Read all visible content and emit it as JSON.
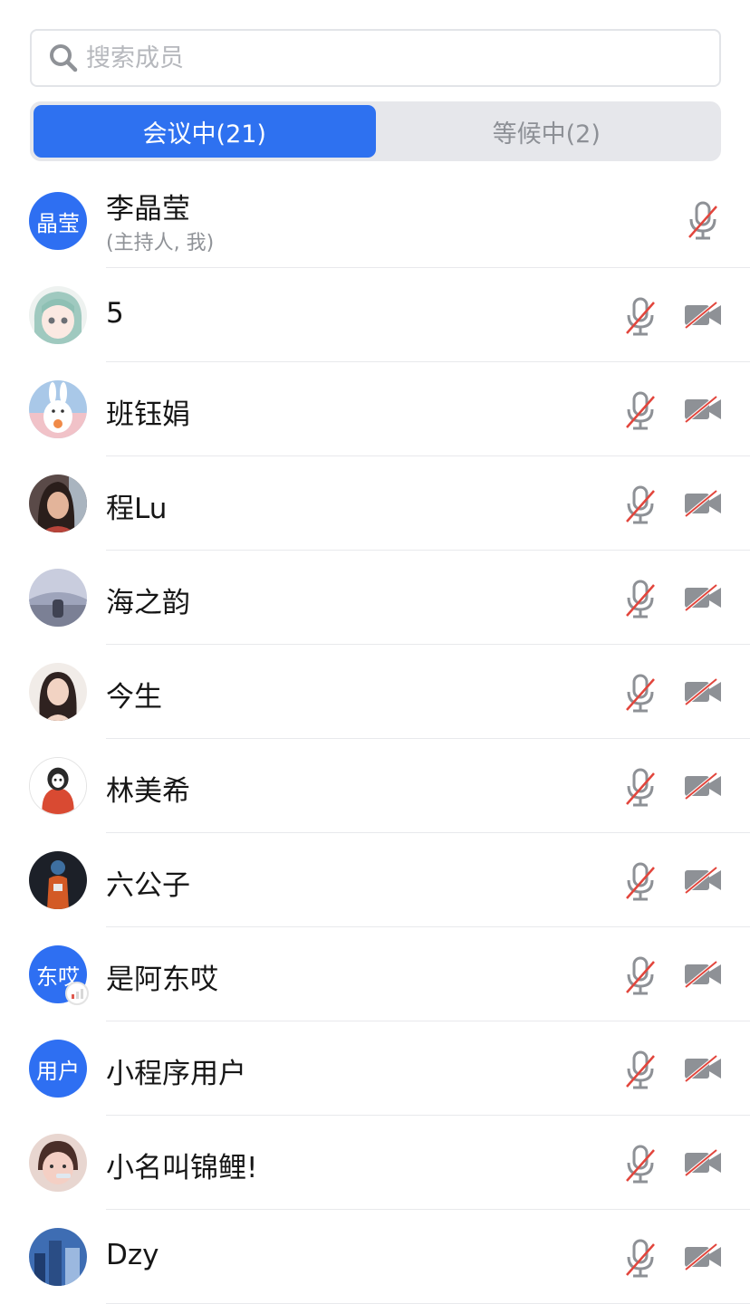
{
  "search": {
    "placeholder": "搜索成员",
    "value": ""
  },
  "tabs": [
    {
      "label": "会议中(21)",
      "active": true
    },
    {
      "label": "等候中(2)",
      "active": false
    }
  ],
  "colors": {
    "accent": "#2e71f0",
    "muted_icon": "#8e9196",
    "strike": "#e2453c"
  },
  "members": [
    {
      "name": "李晶莹",
      "subtitle": "(主持人, 我)",
      "avatar_text": "晶莹",
      "host": true
    },
    {
      "name": "5",
      "avatar_image": "anime-girl-avatar"
    },
    {
      "name": "班钰娟",
      "avatar_image": "rabbit-avatar"
    },
    {
      "name": "程Lu",
      "avatar_image": "woman-photo-avatar"
    },
    {
      "name": "海之韵",
      "avatar_image": "sea-scene-avatar"
    },
    {
      "name": "今生",
      "avatar_image": "woman-portrait-avatar"
    },
    {
      "name": "林美希",
      "avatar_image": "hoodie-cartoon-avatar"
    },
    {
      "name": "六公子",
      "avatar_image": "astronaut-avatar"
    },
    {
      "name": "是阿东哎",
      "avatar_text": "东哎",
      "weak_signal": true
    },
    {
      "name": "小程序用户",
      "avatar_text": "用户"
    },
    {
      "name": "小名叫锦鲤!",
      "avatar_image": "child-photo-avatar"
    },
    {
      "name": "Dzy",
      "avatar_image": "city-blue-avatar"
    }
  ]
}
